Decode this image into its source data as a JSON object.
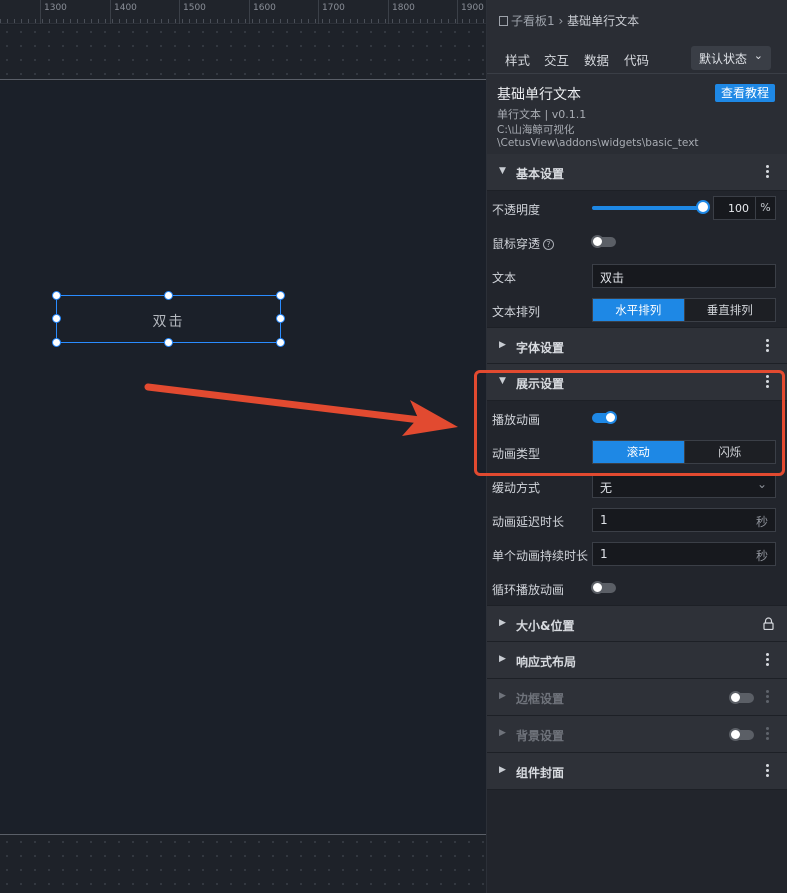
{
  "ruler": {
    "ticks": [
      "1300",
      "1400",
      "1500",
      "1600",
      "1700",
      "1800",
      "1900"
    ]
  },
  "canvas": {
    "selected_text": "双击"
  },
  "colors": {
    "accent": "#1e88e5",
    "highlight": "#e24a30",
    "selection": "#2a8cff"
  },
  "breadcrumb": {
    "parent": "子看板1",
    "separator": "›",
    "current": "基础单行文本"
  },
  "tabs": [
    {
      "label": "样式",
      "active": true
    },
    {
      "label": "交互",
      "active": false
    },
    {
      "label": "数据",
      "active": false
    },
    {
      "label": "代码",
      "active": false
    }
  ],
  "state_select": {
    "value": "默认状态"
  },
  "widget": {
    "title": "基础单行文本",
    "version": "单行文本 | v0.1.1",
    "path_line1": "C:\\山海鲸可视化",
    "path_line2": "\\CetusView\\addons\\widgets\\basic_text",
    "tutorial_label": "查看教程"
  },
  "basic": {
    "title": "基本设置",
    "opacity_label": "不透明度",
    "opacity_value": "100",
    "opacity_unit": "%",
    "mouse_label": "鼠标穿透",
    "mouse_help": "?",
    "mouse_on": false,
    "text_label": "文本",
    "text_value": "双击",
    "arrange_label": "文本排列",
    "arrange_options": [
      "水平排列",
      "垂直排列"
    ],
    "arrange_selected": "水平排列"
  },
  "font": {
    "title": "字体设置"
  },
  "display": {
    "title": "展示设置",
    "play_label": "播放动画",
    "play_on": true,
    "type_label": "动画类型",
    "type_options": [
      "滚动",
      "闪烁"
    ],
    "type_selected": "滚动",
    "easing_label": "缓动方式",
    "easing_value": "无",
    "delay_label": "动画延迟时长",
    "delay_value": "1",
    "delay_unit": "秒",
    "duration_label": "单个动画持续时长",
    "duration_value": "1",
    "duration_unit": "秒",
    "loop_label": "循环播放动画",
    "loop_on": false
  },
  "sections": {
    "size": "大小&位置",
    "responsive": "响应式布局",
    "border": "边框设置",
    "background": "背景设置",
    "cover": "组件封面"
  }
}
